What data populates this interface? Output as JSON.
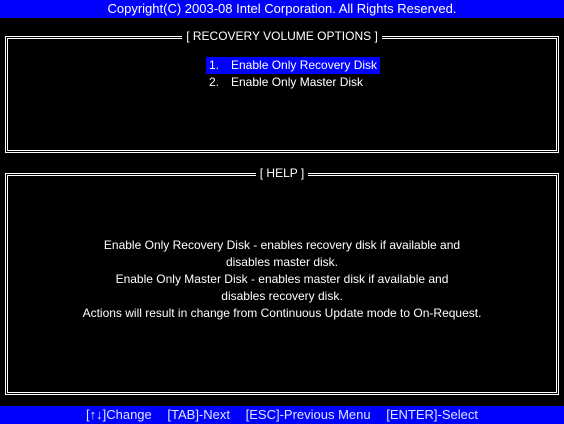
{
  "copyright": "Copyright(C) 2003-08 Intel Corporation. All Rights Reserved.",
  "options_title": "[ RECOVERY VOLUME OPTIONS ]",
  "options": [
    {
      "number": "1.",
      "label": "Enable Only Recovery Disk",
      "selected": true
    },
    {
      "number": "2.",
      "label": "Enable Only Master Disk",
      "selected": false
    }
  ],
  "help_title": "[ HELP ]",
  "help_lines": [
    "Enable Only Recovery Disk - enables recovery disk if available and",
    "disables master disk.",
    "Enable Only Master Disk - enables master disk if available and",
    "disables recovery disk.",
    "Actions will result in change from Continuous Update mode to On-Request."
  ],
  "footer": [
    "[↑↓]Change",
    "[TAB]-Next",
    "[ESC]-Previous Menu",
    "[ENTER]-Select"
  ],
  "colors": {
    "background": "#000000",
    "bar": "#0000ff",
    "text": "#ffffff"
  }
}
